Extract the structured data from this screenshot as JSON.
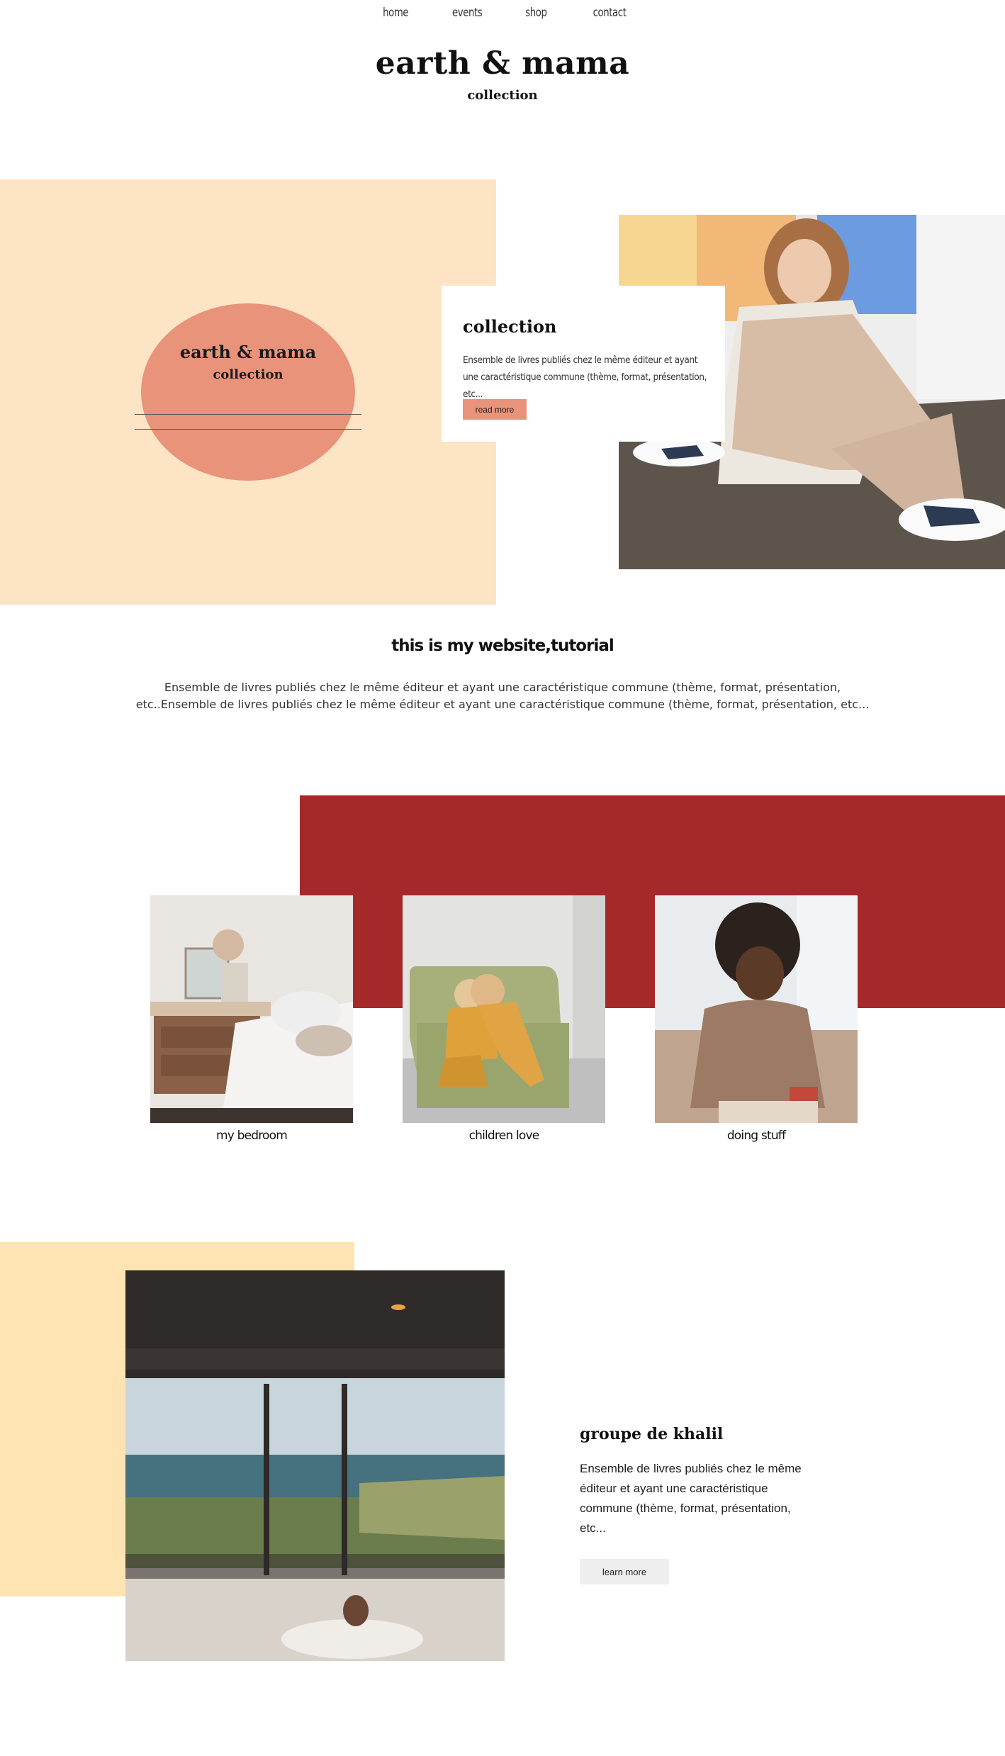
{
  "nav": {
    "home": "home",
    "events": "events",
    "shop": "shop",
    "contact": "contact"
  },
  "header": {
    "title": "earth & mama",
    "subtitle": "collection"
  },
  "hero": {
    "oval_title": "earth & mama",
    "oval_subtitle": "collection",
    "card_title": "collection",
    "card_text": "Ensemble de livres publiés chez le même éditeur et ayant une caractéristique commune (thème, format, présentation, etc...",
    "card_button": "read more"
  },
  "intro": {
    "title": "this is my website,tutorial",
    "text": "Ensemble de livres publiés chez le même éditeur et ayant une caractéristique commune (thème, format, présentation, etc..Ensemble de livres publiés chez le même éditeur et ayant une caractéristique commune (thème, format, présentation, etc..."
  },
  "gallery": [
    {
      "caption": "my bedroom"
    },
    {
      "caption": "children love"
    },
    {
      "caption": "doing stuff"
    }
  ],
  "group": {
    "title": "groupe de khalil",
    "text": "Ensemble de livres publiés chez le même éditeur et ayant une caractéristique commune (thème, format, présentation, etc...",
    "button": "learn more"
  },
  "colors": {
    "peach": "#fde4c4",
    "salmon": "#e8937a",
    "red": "#a5292a",
    "yellow": "#ffe4b3"
  }
}
